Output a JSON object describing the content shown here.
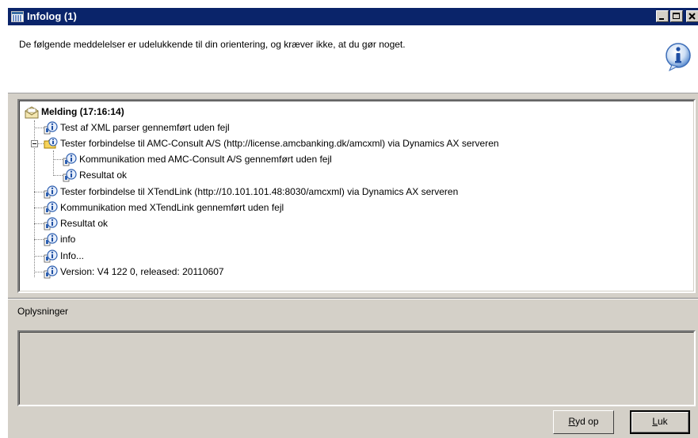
{
  "window": {
    "title": "Infolog (1)",
    "minimize_icon": "minimize-icon",
    "maximize_icon": "maximize-icon",
    "close_icon": "close-icon"
  },
  "banner": {
    "message": "De følgende meddelelser er udelukkende til din orientering, og kræver ikke, at du gør noget.",
    "icon": "info-icon"
  },
  "tree": {
    "root": {
      "label": "Melding (17:16:14)",
      "icon": "envelope-icon"
    },
    "items": [
      {
        "label": "Test af XML parser gennemført uden fejl",
        "icon": "info-icon"
      },
      {
        "label": "Tester forbindelse til AMC-Consult A/S (http://license.amcbanking.dk/amcxml) via Dynamics AX serveren",
        "icon": "folder-info-icon"
      },
      {
        "label": "Kommunikation med AMC-Consult A/S gennemført uden fejl",
        "icon": "info-icon"
      },
      {
        "label": "Resultat ok",
        "icon": "info-icon"
      },
      {
        "label": "Tester forbindelse til XTendLink (http://10.101.101.48:8030/amcxml) via Dynamics AX serveren",
        "icon": "info-icon"
      },
      {
        "label": "Kommunikation med XTendLink gennemført uden fejl",
        "icon": "info-icon"
      },
      {
        "label": "Resultat ok",
        "icon": "info-icon"
      },
      {
        "label": "info",
        "icon": "info-icon"
      },
      {
        "label": "Info...",
        "icon": "info-icon"
      },
      {
        "label": "Version: V4 122 0, released: 20110607",
        "icon": "info-icon"
      }
    ]
  },
  "details": {
    "label": "Oplysninger"
  },
  "buttons": {
    "ryd_op": {
      "accel": "R",
      "rest": "yd op"
    },
    "luk": {
      "accel": "L",
      "rest": "uk"
    }
  },
  "colors": {
    "titlebar": "#0a246a",
    "face": "#d4d0c8"
  }
}
